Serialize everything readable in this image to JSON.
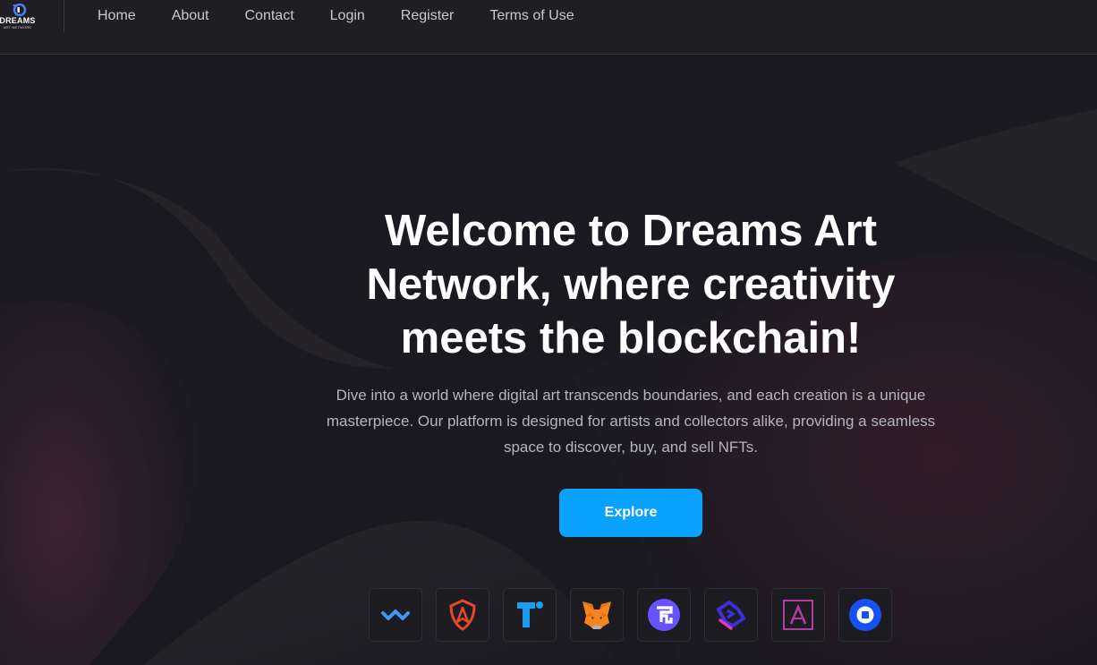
{
  "logo": {
    "title": "DREAMS",
    "subtitle": "ART NETWORK"
  },
  "nav": {
    "items": [
      "Home",
      "About",
      "Contact",
      "Login",
      "Register",
      "Terms of Use"
    ]
  },
  "hero": {
    "title": "Welcome to Dreams Art Network, where creativity meets the blockchain!",
    "description": "Dive into a world where digital art transcends boundaries, and each creation is a unique masterpiece. Our platform is designed for artists and collectors alike, providing a seamless space to discover, buy, and sell NFTs.",
    "button_label": "Explore"
  },
  "wallets": [
    {
      "icon": "walletconnect-icon"
    },
    {
      "icon": "trust-shield-icon"
    },
    {
      "icon": "t-logo-icon"
    },
    {
      "icon": "metamask-fox-icon"
    },
    {
      "icon": "fortmatic-icon"
    },
    {
      "icon": "bitski-icon"
    },
    {
      "icon": "arkane-icon"
    },
    {
      "icon": "coinbase-icon"
    }
  ],
  "colors": {
    "accent": "#0aa2ff",
    "header_bg": "#1f1f23",
    "page_bg": "#17171f"
  }
}
